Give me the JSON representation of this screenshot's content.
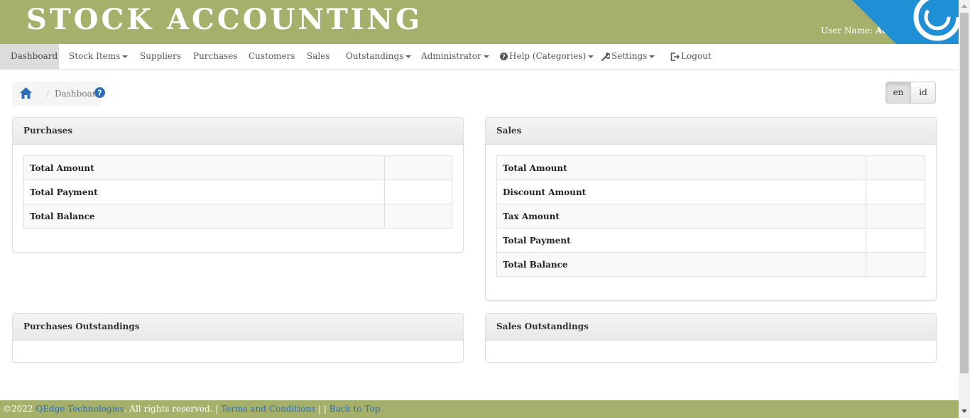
{
  "header": {
    "brand": "STOCK ACCOUNTING",
    "user_label": "User Name:",
    "user_name": "Admi"
  },
  "nav": {
    "dashboard": "Dashboard",
    "stock_items": "Stock Items",
    "suppliers": "Suppliers",
    "purchases": "Purchases",
    "customers": "Customers",
    "sales": "Sales",
    "outstandings": "Outstandings",
    "administrator": "Administrator",
    "help": "Help (Categories)",
    "settings": "Settings",
    "logout": "Logout"
  },
  "breadcrumb": {
    "separator": "/",
    "current": "Dashboard"
  },
  "lang": {
    "en": "en",
    "id": "id"
  },
  "purchases_panel": {
    "title": "Purchases",
    "rows": [
      {
        "label": "Total Amount",
        "value": ""
      },
      {
        "label": "Total Payment",
        "value": ""
      },
      {
        "label": "Total Balance",
        "value": ""
      }
    ]
  },
  "sales_panel": {
    "title": "Sales",
    "rows": [
      {
        "label": "Total Amount",
        "value": ""
      },
      {
        "label": "Discount Amount",
        "value": ""
      },
      {
        "label": "Tax Amount",
        "value": ""
      },
      {
        "label": "Total Payment",
        "value": ""
      },
      {
        "label": "Total Balance",
        "value": ""
      }
    ]
  },
  "purchases_outstandings": {
    "title": "Purchases Outstandings"
  },
  "sales_outstandings": {
    "title": "Sales Outstandings"
  },
  "footer": {
    "copyright": "©2022",
    "company": "QEdge Technologies",
    "rights": ". All rights reserved. |",
    "terms": "Terms and Conditions",
    "sep": "| |",
    "back_to_top": "Back to Top"
  },
  "colors": {
    "header_bg": "#a5b16b",
    "link": "#2a6ebb",
    "corner_accent": "#1f8fd6"
  },
  "icons": {
    "home": "home-icon",
    "help": "question-circle-icon",
    "settings": "wrench-icon",
    "logout": "logout-icon"
  }
}
